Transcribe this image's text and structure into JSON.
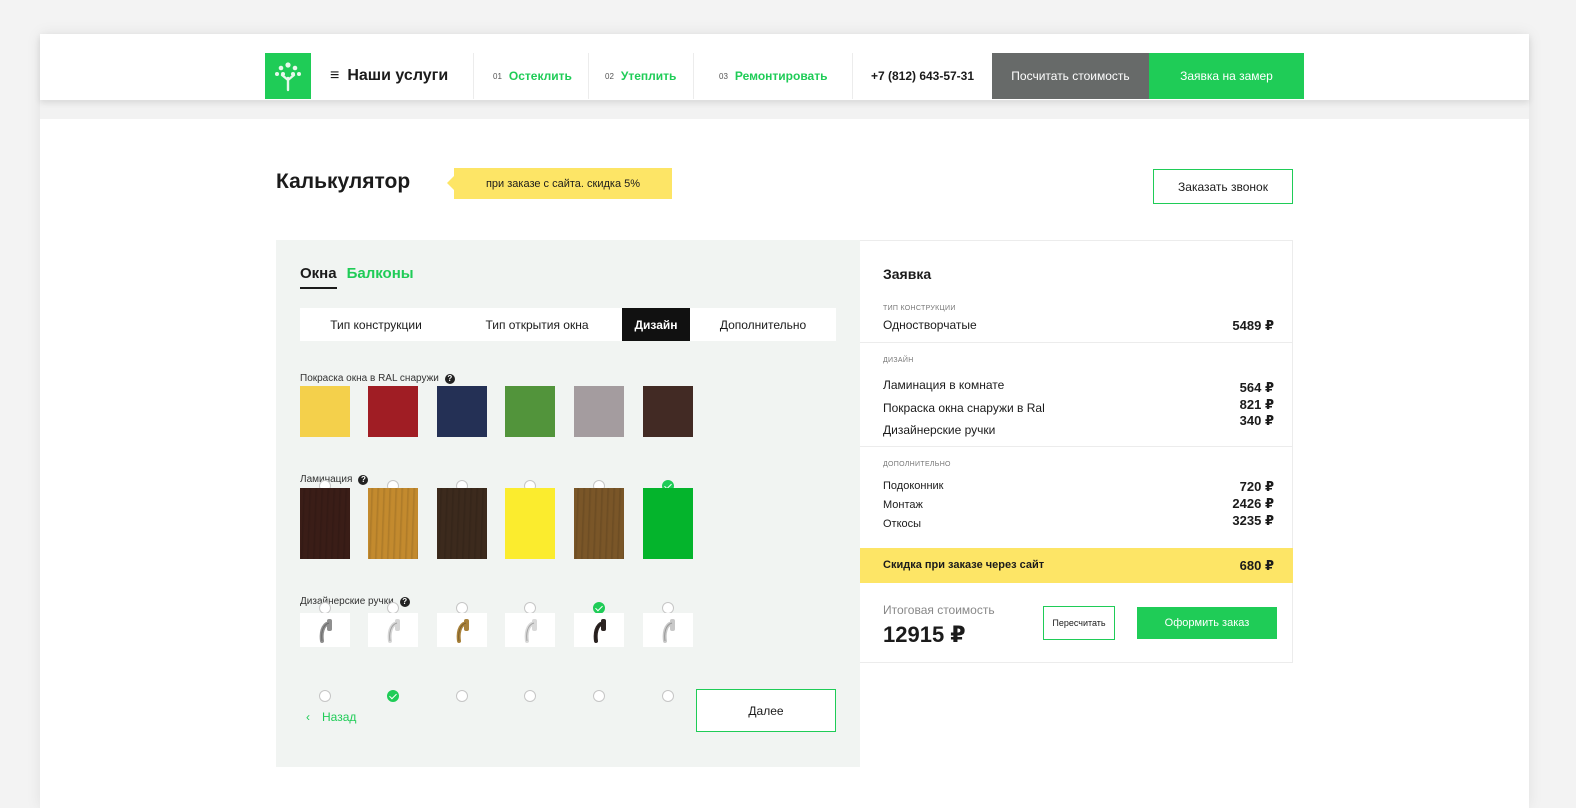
{
  "header": {
    "menu_icon": "≡",
    "menu_label": "Наши услуги",
    "nav": [
      {
        "num": "01",
        "label": "Остеклить"
      },
      {
        "num": "02",
        "label": "Утеплить"
      },
      {
        "num": "03",
        "label": "Ремонтировать"
      }
    ],
    "phone": "+7 (812) 643-57-31",
    "calc_button": "Посчитать стоимость",
    "zamer_button": "Заявка на замер",
    "logo_icon": "tree-logo-icon",
    "accent_color": "#1fcc57"
  },
  "calculator": {
    "title": "Калькулятор",
    "promo": "при заказе с сайта. скидка 5%",
    "call_button": "Заказать звонок",
    "tabs": [
      "Окна",
      "Балконы"
    ],
    "steps": [
      "Тип конструкции",
      "Тип открытия окна",
      "Дизайн",
      "Дополнительно"
    ],
    "active_step": "Дизайн",
    "paint": {
      "label": "Покраска окна в RAL снаружи",
      "help": "?",
      "colors": [
        "#f4d04b",
        "#a01d24",
        "#243055",
        "#52943b",
        "#a49c9f",
        "#422a24"
      ],
      "selected": 5
    },
    "lamination": {
      "label": "Ламинация",
      "help": "?",
      "colors": [
        "#3a1d17",
        "#c38a2e",
        "#3c2a1d",
        "#fbec2e",
        "#7a5628",
        "#04b42c"
      ],
      "selected": 4
    },
    "handles": {
      "label": "Дизайнерские ручки",
      "help": "?",
      "colors": [
        "#8f8f8f",
        "#d6d6d6",
        "#a8813a",
        "#d9d9d9",
        "#2c2422",
        "#c8c8c8"
      ],
      "selected": 1
    },
    "back_icon": "‹",
    "back_label": "Назад",
    "next_label": "Далее"
  },
  "order": {
    "title": "Заявка",
    "construction": {
      "caption": "тип конструкции",
      "items": [
        {
          "name": "Одностворчатые",
          "price": "5489 ₽"
        }
      ]
    },
    "design": {
      "caption": "дизайн",
      "items": [
        {
          "name": "Ламинация в комнате",
          "price": "564 ₽"
        },
        {
          "name": "Покраска окна снаружи в Ral",
          "price": "821 ₽"
        },
        {
          "name": "Дизайнерские ручки",
          "price": "340 ₽"
        }
      ]
    },
    "extra": {
      "caption": "дополнительно",
      "items": [
        {
          "name": "Подоконник",
          "price": "720 ₽"
        },
        {
          "name": "Монтаж",
          "price": "2426 ₽"
        },
        {
          "name": "Откосы",
          "price": "3235 ₽"
        }
      ]
    },
    "discount_label": "Скидка при заказе через сайт",
    "discount_value": "680 ₽",
    "total_caption": "Итоговая стоимость",
    "total_value": "12915 ₽",
    "recalc_button": "Пересчитать",
    "order_button": "Оформить заказ"
  }
}
